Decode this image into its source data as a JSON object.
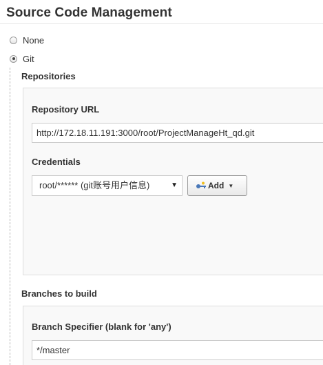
{
  "section": {
    "title": "Source Code Management"
  },
  "scm_options": [
    {
      "label": "None",
      "checked": false
    },
    {
      "label": "Git",
      "checked": true
    }
  ],
  "repositories": {
    "heading": "Repositories",
    "url_label": "Repository URL",
    "url_value": "http://172.18.11.191:3000/root/ProjectManageHt_qd.git",
    "credentials_label": "Credentials",
    "credentials_selected": "root/****** (git账号用户信息)",
    "add_label": "Add",
    "icons": {
      "key": "key-icon",
      "dropdown": "caret-down-icon"
    }
  },
  "branches": {
    "heading": "Branches to build",
    "specifier_label": "Branch Specifier (blank for 'any')",
    "specifier_value": "*/master"
  }
}
